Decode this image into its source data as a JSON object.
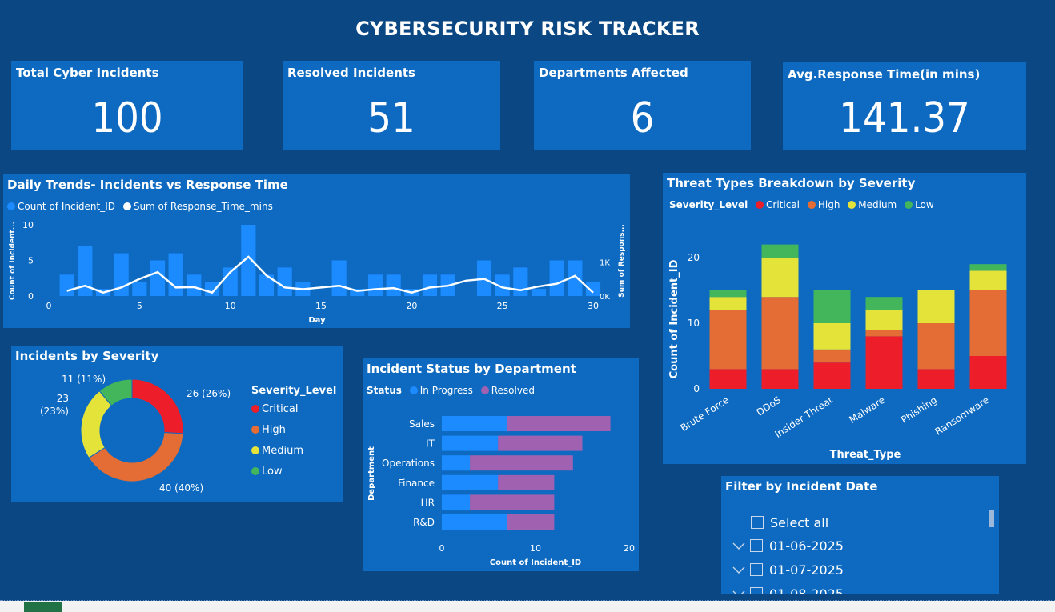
{
  "title": "CYBERSECURITY RISK TRACKER",
  "kpis": [
    {
      "label": "Total Cyber Incidents",
      "value": "100"
    },
    {
      "label": "Resolved Incidents",
      "value": "51"
    },
    {
      "label": "Departments Affected",
      "value": "6"
    },
    {
      "label": "Avg.Response Time(in mins)",
      "value": "141.37"
    }
  ],
  "colors": {
    "critical": "#ee1d2a",
    "high": "#e46c35",
    "medium": "#e4e33a",
    "low": "#43b65c",
    "in_progress": "#1c8bff",
    "resolved": "#a062b0",
    "bar": "#1c8bff",
    "line": "#ffffff"
  },
  "daily": {
    "title": "Daily Trends- Incidents vs Response Time",
    "legend": [
      "Count of Incident_ID",
      "Sum of Response_Time_mins"
    ],
    "y_left_label": "Count of Incident...",
    "y_right_label": "Sum of Respons...",
    "x_label": "Day",
    "x_ticks": [
      "0",
      "5",
      "10",
      "15",
      "20",
      "25",
      "30"
    ],
    "y_left_ticks": [
      "0",
      "5",
      "10"
    ],
    "y_right_ticks": [
      "0K",
      "1K"
    ]
  },
  "severity_donut": {
    "title": "Incidents by Severity",
    "legend_title": "Severity_Level",
    "labels": [
      "26 (26%)",
      "40 (40%)",
      "23\n(23%)",
      "11 (11%)"
    ]
  },
  "status_dept": {
    "title": "Incident Status by Department",
    "legend_title": "Status",
    "y_label": "Department",
    "x_label": "Count of Incident_ID",
    "x_ticks": [
      "0",
      "10",
      "20"
    ]
  },
  "threat": {
    "title": "Threat Types Breakdown by Severity",
    "legend_title": "Severity_Level",
    "y_label": "Count of Incident_ID",
    "x_label": "Threat_Type",
    "y_ticks": [
      "0",
      "10",
      "20"
    ]
  },
  "slicer": {
    "title": "Filter by Incident Date",
    "items": [
      "Select all",
      "01-06-2025",
      "01-07-2025",
      "01-08-2025"
    ]
  },
  "chart_data": [
    {
      "type": "bar",
      "title": "Daily Trends- Incidents vs Response Time",
      "xlabel": "Day",
      "ylabel": "Count of Incident...",
      "xlim": [
        0,
        30
      ],
      "ylim": [
        0,
        10
      ],
      "y2lim": [
        0,
        1500
      ],
      "x": [
        1,
        2,
        3,
        4,
        5,
        6,
        7,
        8,
        9,
        10,
        11,
        12,
        13,
        14,
        15,
        16,
        17,
        18,
        19,
        20,
        21,
        22,
        23,
        24,
        25,
        26,
        27,
        28,
        29,
        30
      ],
      "series": [
        {
          "name": "Count of Incident_ID",
          "type": "bar",
          "values": [
            3,
            7,
            1,
            6,
            2,
            5,
            6,
            3,
            2,
            4,
            10,
            3,
            4,
            2,
            0,
            5,
            1,
            3,
            3,
            1,
            3,
            3,
            0,
            5,
            3,
            4,
            1,
            5,
            5,
            2
          ]
        },
        {
          "name": "Sum of Response_Time_mins",
          "type": "line",
          "axis": "right",
          "values": [
            150,
            300,
            100,
            250,
            500,
            700,
            250,
            260,
            100,
            700,
            1150,
            600,
            250,
            200,
            250,
            300,
            150,
            200,
            230,
            100,
            250,
            300,
            450,
            500,
            250,
            170,
            280,
            360,
            590,
            100
          ]
        }
      ]
    },
    {
      "type": "pie",
      "title": "Incidents by Severity",
      "legend_title": "Severity_Level",
      "categories": [
        "Critical",
        "High",
        "Medium",
        "Low"
      ],
      "values": [
        26,
        40,
        23,
        11
      ],
      "percent_labels": [
        "26%",
        "40%",
        "23%",
        "11%"
      ]
    },
    {
      "type": "bar",
      "orientation": "horizontal",
      "stacked": true,
      "title": "Incident Status by Department",
      "xlabel": "Count of Incident_ID",
      "ylabel": "Department",
      "xlim": [
        0,
        20
      ],
      "categories": [
        "Sales",
        "IT",
        "Operations",
        "Finance",
        "HR",
        "R&D"
      ],
      "series": [
        {
          "name": "In Progress",
          "values": [
            7,
            6,
            3,
            6,
            3,
            7
          ]
        },
        {
          "name": "Resolved",
          "values": [
            11,
            9,
            11,
            6,
            9,
            5
          ]
        }
      ]
    },
    {
      "type": "bar",
      "stacked": true,
      "title": "Threat Types Breakdown by Severity",
      "xlabel": "Threat_Type",
      "ylabel": "Count of Incident_ID",
      "ylim": [
        0,
        24
      ],
      "categories": [
        "Brute Force",
        "DDoS",
        "Insider Threat",
        "Malware",
        "Phishing",
        "Ransomware"
      ],
      "series": [
        {
          "name": "Critical",
          "values": [
            3,
            3,
            4,
            8,
            3,
            5
          ]
        },
        {
          "name": "High",
          "values": [
            9,
            11,
            2,
            1,
            7,
            10
          ]
        },
        {
          "name": "Medium",
          "values": [
            2,
            6,
            4,
            3,
            5,
            3
          ]
        },
        {
          "name": "Low",
          "values": [
            1,
            2,
            5,
            2,
            0,
            1
          ]
        }
      ]
    }
  ]
}
